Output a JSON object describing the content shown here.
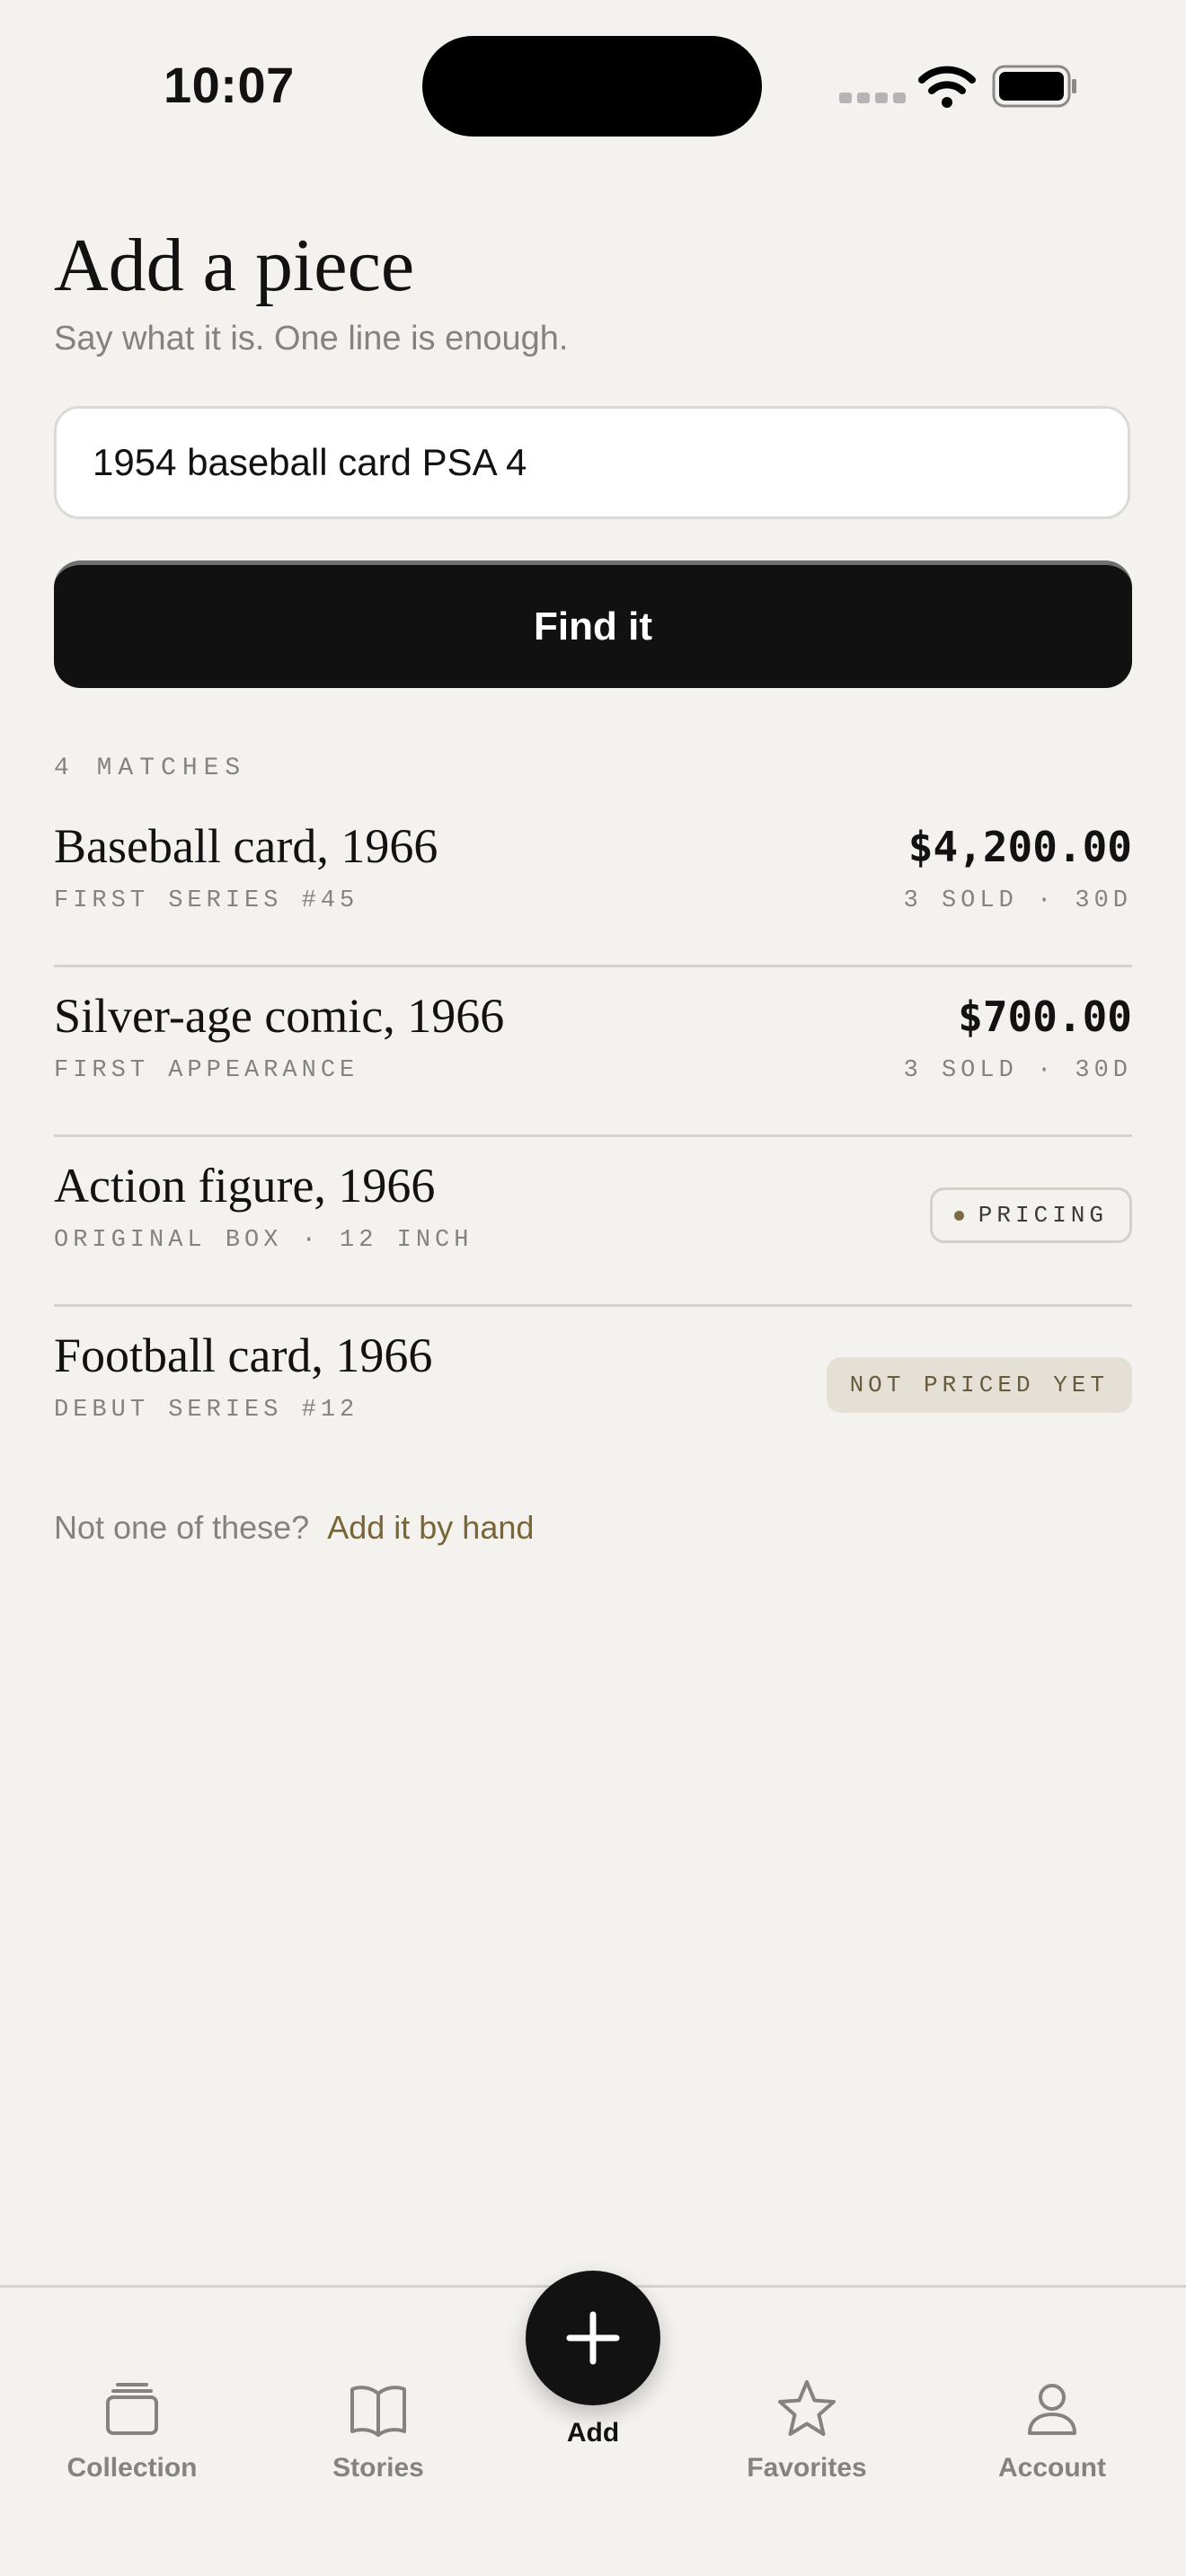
{
  "status_bar": {
    "time": "10:07",
    "icons": [
      "signal-icon",
      "wifi-icon",
      "battery-icon"
    ]
  },
  "header": {
    "title": "Add a piece",
    "subtitle": "Say what it is. One line is enough."
  },
  "search": {
    "value": "1954 baseball card PSA 4",
    "button_label": "Find it"
  },
  "results": {
    "count_label": "4 MATCHES",
    "items": [
      {
        "title": "Baseball card, 1966",
        "subtitle": "FIRST SERIES #45",
        "price": "$4,200.00",
        "meta": "3 SOLD · 30D"
      },
      {
        "title": "Silver-age comic, 1966",
        "subtitle": "FIRST APPEARANCE",
        "price": "$700.00",
        "meta": "3 SOLD · 30D"
      },
      {
        "title": "Action figure, 1966",
        "subtitle": "ORIGINAL BOX · 12 INCH",
        "status": "PRICING"
      },
      {
        "title": "Football card, 1966",
        "subtitle": "DEBUT SERIES #12",
        "status": "NOT PRICED YET"
      }
    ]
  },
  "manual": {
    "prompt": "Not one of these?",
    "link": "Add it by hand"
  },
  "tab_bar": {
    "tabs": [
      {
        "label": "Collection",
        "icon": "collection-icon"
      },
      {
        "label": "Stories",
        "icon": "book-icon"
      },
      {
        "label": "Add",
        "icon": "plus-icon"
      },
      {
        "label": "Favorites",
        "icon": "star-icon"
      },
      {
        "label": "Account",
        "icon": "person-icon"
      }
    ]
  },
  "colors": {
    "background": "#f4f2ee",
    "text": "#121212",
    "muted": "#858380",
    "accent": "#7a6536",
    "button": "#111111",
    "divider": "#d6d3ce",
    "unpriced_chip": "#e5e0d6"
  }
}
